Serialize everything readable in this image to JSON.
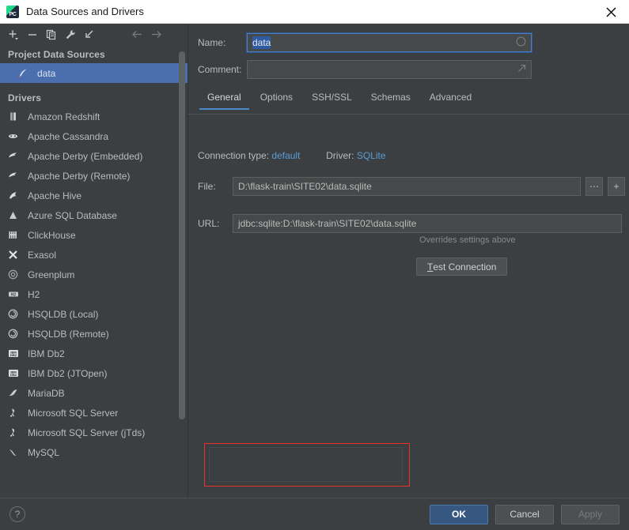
{
  "window": {
    "title": "Data Sources and Drivers",
    "app_icon": "pycharm-icon",
    "close_label": "✕"
  },
  "left_panel": {
    "toolbar": [
      {
        "name": "add-button",
        "glyph": "+"
      },
      {
        "name": "remove-button",
        "glyph": "−"
      },
      {
        "name": "duplicate-button",
        "glyph": "copy"
      },
      {
        "name": "properties-wrench-button",
        "glyph": "wrench"
      },
      {
        "name": "import-button",
        "glyph": "arrow-into"
      }
    ],
    "nav": [
      {
        "name": "back-button",
        "glyph": "←"
      },
      {
        "name": "forward-button",
        "glyph": "→"
      }
    ],
    "project_sources_header": "Project Data Sources",
    "data_sources": [
      {
        "label": "data",
        "selected": true,
        "icon": "sqlite-icon"
      }
    ],
    "drivers_header": "Drivers",
    "drivers": [
      {
        "label": "Amazon Redshift",
        "icon": "redshift-icon"
      },
      {
        "label": "Apache Cassandra",
        "icon": "cassandra-icon"
      },
      {
        "label": "Apache Derby (Embedded)",
        "icon": "derby-icon"
      },
      {
        "label": "Apache Derby (Remote)",
        "icon": "derby-icon"
      },
      {
        "label": "Apache Hive",
        "icon": "hive-icon"
      },
      {
        "label": "Azure SQL Database",
        "icon": "azure-icon"
      },
      {
        "label": "ClickHouse",
        "icon": "clickhouse-icon"
      },
      {
        "label": "Exasol",
        "icon": "exasol-icon"
      },
      {
        "label": "Greenplum",
        "icon": "greenplum-icon"
      },
      {
        "label": "H2",
        "icon": "h2-icon"
      },
      {
        "label": "HSQLDB (Local)",
        "icon": "hsqldb-icon"
      },
      {
        "label": "HSQLDB (Remote)",
        "icon": "hsqldb-icon"
      },
      {
        "label": "IBM Db2",
        "icon": "ibmdb2-icon"
      },
      {
        "label": "IBM Db2 (JTOpen)",
        "icon": "ibmdb2-icon"
      },
      {
        "label": "MariaDB",
        "icon": "mariadb-icon"
      },
      {
        "label": "Microsoft SQL Server",
        "icon": "mssql-icon"
      },
      {
        "label": "Microsoft SQL Server (jTds)",
        "icon": "mssql-icon"
      },
      {
        "label": "MySQL",
        "icon": "mysql-icon"
      }
    ]
  },
  "right_panel": {
    "name_label": "Name:",
    "name_value": "data",
    "name_selected": true,
    "comment_label": "Comment:",
    "comment_value": "",
    "tabs": [
      {
        "label": "General",
        "active": true
      },
      {
        "label": "Options",
        "active": false
      },
      {
        "label": "SSH/SSL",
        "active": false
      },
      {
        "label": "Schemas",
        "active": false
      },
      {
        "label": "Advanced",
        "active": false
      }
    ],
    "connection_type_label": "Connection type:",
    "connection_type_value": "default",
    "driver_label": "Driver:",
    "driver_value": "SQLite",
    "file_label": "File:",
    "file_value": "D:\\flask-train\\SITE02\\data.sqlite",
    "browse_button": "⋯",
    "add_button": "+",
    "url_label": "URL:",
    "url_value": "jdbc:sqlite:D:\\flask-train\\SITE02\\data.sqlite",
    "overrides_note": "Overrides settings above",
    "test_connection": {
      "mnemonic": "T",
      "rest": "est Connection"
    }
  },
  "bottom": {
    "help_label": "?",
    "ok_label": "OK",
    "cancel_label": "Cancel",
    "apply_label": "Apply",
    "apply_disabled": true
  },
  "colors": {
    "background": "#3c3f41",
    "selection": "#4b6eaf",
    "accent_link": "#5b9bd5",
    "primary_button": "#365880",
    "annotation": "#e8312a",
    "titlebar": "#ffffff"
  }
}
